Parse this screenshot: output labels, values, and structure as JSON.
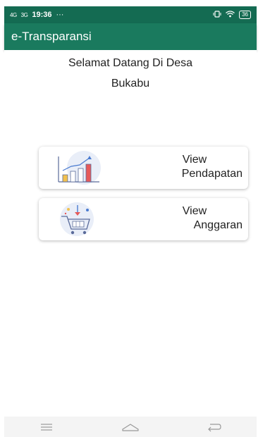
{
  "status_bar": {
    "network_left": "4G",
    "network_right": "3G",
    "time": "19:36",
    "more": "···",
    "battery": "36"
  },
  "app_bar": {
    "title": "e-Transparansi"
  },
  "welcome": {
    "line1": "Selamat Datang Di Desa",
    "line2": "Bukabu"
  },
  "cards": [
    {
      "line1": "View",
      "line2": "Pendapatan",
      "icon": "bar-chart-growth-icon"
    },
    {
      "line1": "View",
      "line2": "Anggaran",
      "icon": "shopping-cart-icon"
    }
  ],
  "nav": {
    "items": [
      "menu-icon",
      "home-icon",
      "back-icon"
    ]
  },
  "colors": {
    "primary": "#1a7a5e",
    "status": "#146b52",
    "background": "#ffffff"
  }
}
